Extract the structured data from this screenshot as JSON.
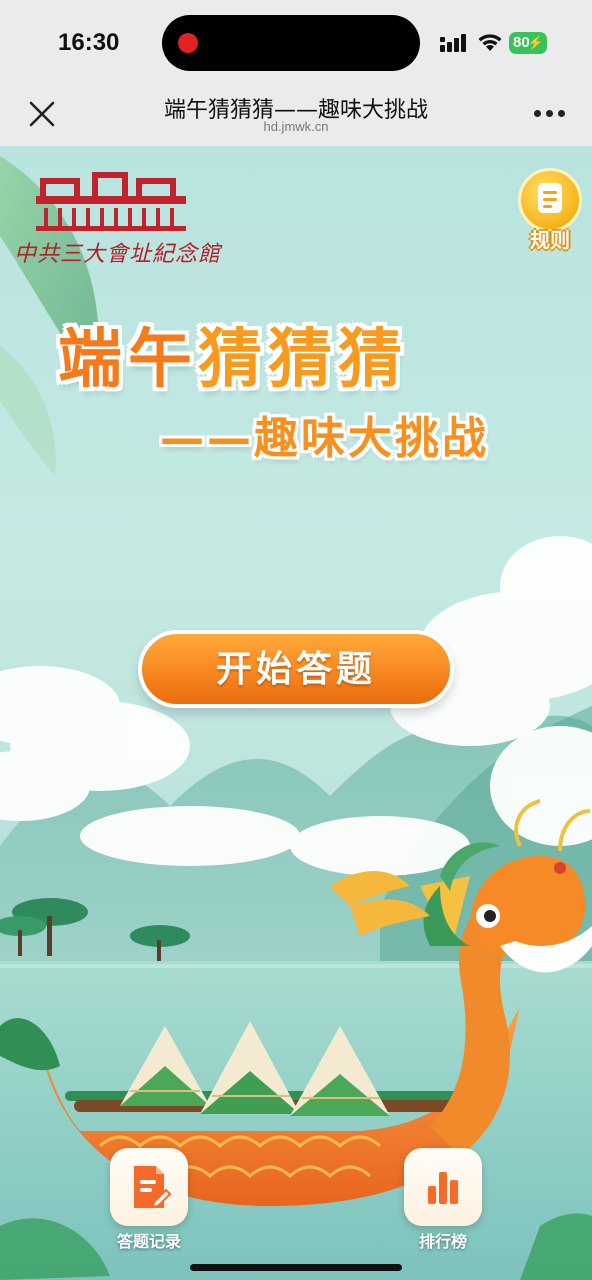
{
  "status_bar": {
    "time": "16:30",
    "battery": "80",
    "icons": [
      "recording-dot",
      "signal-icon",
      "wifi-icon",
      "battery-icon"
    ]
  },
  "nav": {
    "title": "端午猜猜猜——趣味大挑战",
    "url": "hd.jmwk.cn",
    "close_icon": "close-icon",
    "more_icon": "more-icon"
  },
  "logo": {
    "caption": "中共三大會址紀念館"
  },
  "rules": {
    "label": "规则",
    "icon": "document-icon"
  },
  "headline": {
    "line1_part1": "端午",
    "line1_part2": "猜猜猜",
    "line2": "——趣味大挑战"
  },
  "start_button": {
    "label": "开始答题"
  },
  "bottom_actions": [
    {
      "label": "答题记录",
      "icon": "document-edit-icon"
    },
    {
      "label": "排行榜",
      "icon": "bar-chart-icon"
    }
  ],
  "colors": {
    "accent_orange": "#f47a1c",
    "sky": "#bfe5df",
    "logo_red": "#b3202a",
    "rules_gold": "#f6b41a"
  }
}
